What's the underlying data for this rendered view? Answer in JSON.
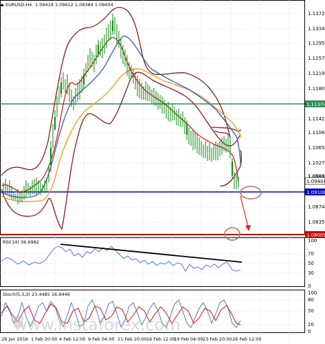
{
  "main_header": {
    "symbol": "EURUSD,H4",
    "ohlc": "1.09419 1.09612 1.09384 1.09404"
  },
  "rsi_header": "RSI(14) 36.9982",
  "stoch_header": "Stoch(5,3,3) 23.4485 16.9446",
  "price_axis": [
    "1.13720",
    "1.13340",
    "1.12950",
    "1.12570",
    "1.12190",
    "1.11800",
    "1.11420",
    "1.11060",
    "1.10650",
    "1.10270",
    "1.09890",
    "1.09500",
    "1.09100",
    "1.08740",
    "1.08350"
  ],
  "rsi_axis": [
    "100",
    "70",
    "50",
    "30",
    "0"
  ],
  "stoch_axis": [
    "100",
    "80",
    "50",
    "20",
    "0"
  ],
  "price_tags": [
    {
      "value": "1.11374",
      "color": "#2e8b57"
    },
    {
      "value": "1.09404",
      "color": "#ffffff"
    },
    {
      "value": "1.09108",
      "color": "#0000cc"
    },
    {
      "value": "1.08009",
      "color": "#cc0000"
    }
  ],
  "time_axis": [
    "28 Jan 2016",
    "1 Feb 20:00",
    "4 Feb 12:00",
    "9 Feb 04:00",
    "11 Feb 20:00",
    "16 Feb 12:00",
    "19 Feb 04:00",
    "23 Feb 20:00",
    "26 Feb 12:00"
  ],
  "watermark": "www.instaforex.com"
}
